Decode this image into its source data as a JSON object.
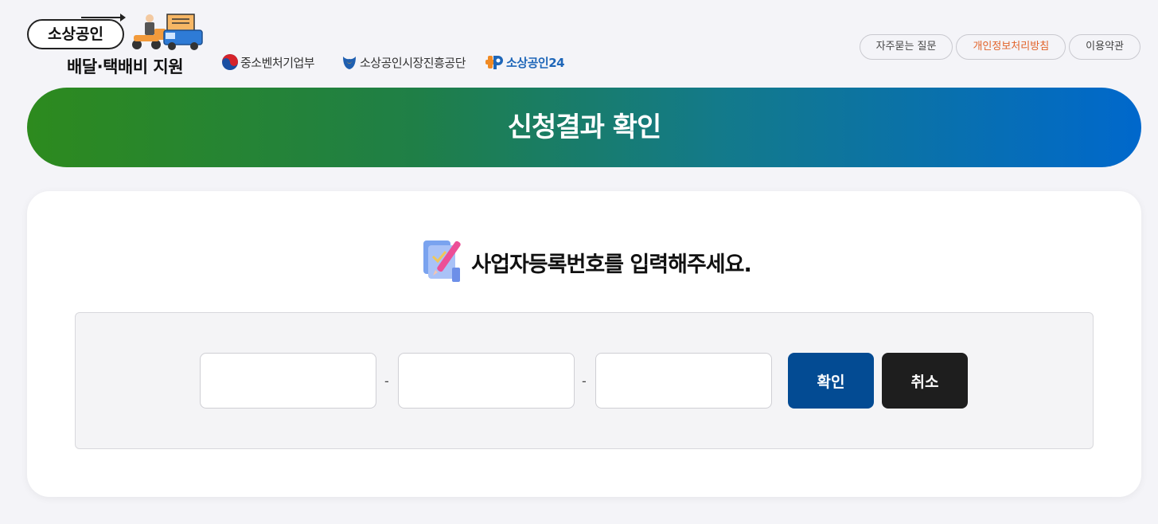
{
  "logo": {
    "title": "소상공인",
    "subtitle": "배달·택배비 지원"
  },
  "partners": {
    "ministry": "중소벤처기업부",
    "agency": "소상공인시장진흥공단",
    "portal": "소상공인24"
  },
  "top_links": {
    "faq": "자주묻는 질문",
    "privacy": "개인정보처리방침",
    "terms": "이용약관"
  },
  "banner": {
    "title": "신청결과 확인"
  },
  "form": {
    "prompt": "사업자등록번호를 입력해주세요.",
    "part1_value": "",
    "part2_value": "",
    "part3_value": "",
    "separator": "-",
    "confirm_label": "확인",
    "cancel_label": "취소"
  },
  "colors": {
    "banner_start": "#2d8a1e",
    "banner_end": "#0068cc",
    "confirm_button": "#034b93",
    "cancel_button": "#1e1e1e",
    "privacy_link": "#e2632a"
  },
  "icons": {
    "logo_art": "delivery-scooter-truck-icon",
    "ministry": "taegeuk-icon",
    "agency": "agency-emblem-icon",
    "portal": "plus-p-icon",
    "prompt": "pencil-document-icon"
  }
}
